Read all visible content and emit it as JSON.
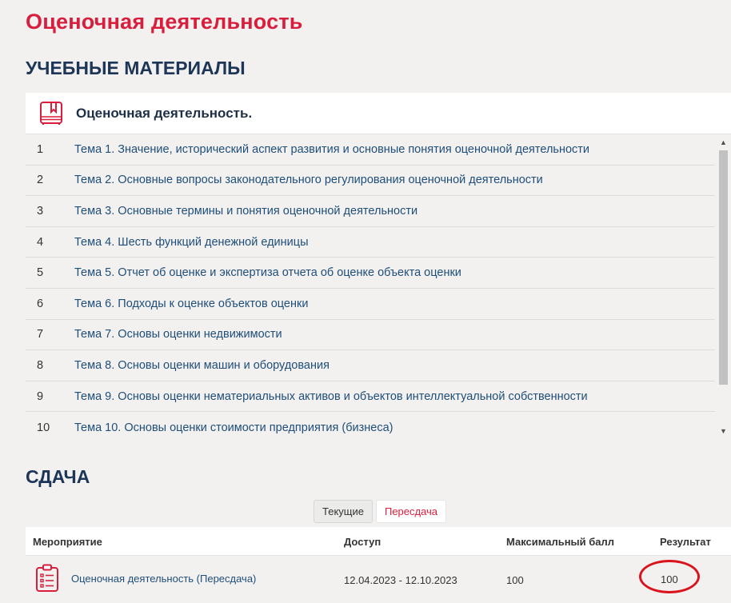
{
  "page": {
    "title": "Оценочная деятельность"
  },
  "materials": {
    "section_title": "УЧЕБНЫЕ МАТЕРИАЛЫ",
    "course_title": "Оценочная деятельность.",
    "icon": "book-icon",
    "items": [
      {
        "num": "1",
        "label": "Тема 1. Значение, исторический аспект развития и основные понятия оценочной деятельности"
      },
      {
        "num": "2",
        "label": "Тема 2. Основные вопросы законодательного регулирования оценочной деятельности"
      },
      {
        "num": "3",
        "label": "Тема 3. Основные термины и понятия оценочной деятельности"
      },
      {
        "num": "4",
        "label": "Тема 4. Шесть функций денежной единицы"
      },
      {
        "num": "5",
        "label": "Тема 5. Отчет об оценке и экспертиза отчета об оценке объекта оценки"
      },
      {
        "num": "6",
        "label": "Тема 6. Подходы к оценке объектов оценки"
      },
      {
        "num": "7",
        "label": "Тема 7. Основы оценки недвижимости"
      },
      {
        "num": "8",
        "label": "Тема 8. Основы оценки машин и оборудования"
      },
      {
        "num": "9",
        "label": "Тема 9. Основы оценки нематериальных активов и объектов интеллектуальной собственности"
      },
      {
        "num": "10",
        "label": "Тема 10. Основы оценки стоимости предприятия (бизнеса)"
      }
    ]
  },
  "submission": {
    "section_title": "СДАЧА",
    "tabs": {
      "current": "Текущие",
      "retake": "Пересдача"
    },
    "headers": {
      "event": "Мероприятие",
      "access": "Доступ",
      "max_score": "Максимальный балл",
      "result": "Результат"
    },
    "row": {
      "icon": "clipboard-icon",
      "event": "Оценочная деятельность (Пересдача)",
      "access": "12.04.2023 - 12.10.2023",
      "max_score": "100",
      "result": "100"
    }
  },
  "colors": {
    "accent": "#d81e3c",
    "heading": "#1d3557",
    "link": "#1f4e79",
    "highlight_circle": "#d9141d"
  }
}
